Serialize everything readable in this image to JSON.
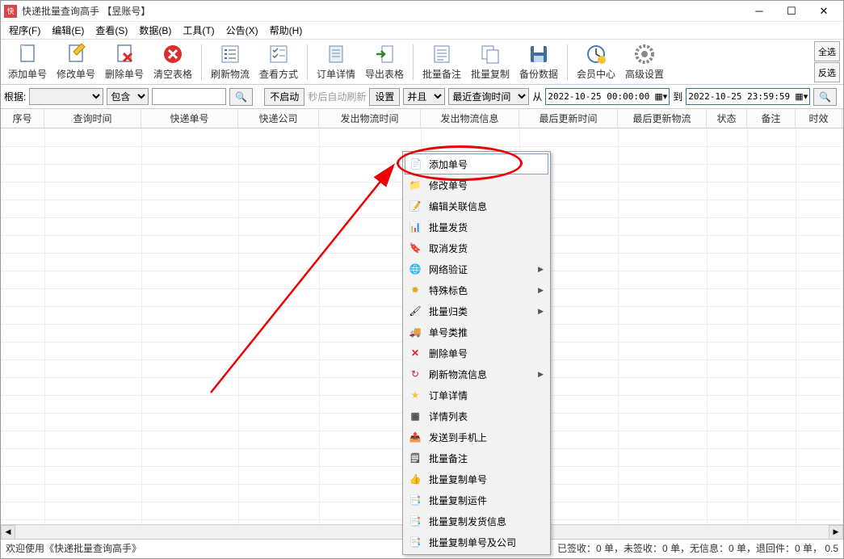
{
  "window": {
    "title": "快递批量查询高手  【昱账号】"
  },
  "menu": {
    "program": "程序(F)",
    "edit": "编辑(E)",
    "view": "查看(S)",
    "data": "数据(B)",
    "tool": "工具(T)",
    "notice": "公告(X)",
    "help": "帮助(H)"
  },
  "toolbar": {
    "add": "添加单号",
    "modify": "修改单号",
    "delete": "删除单号",
    "clear": "清空表格",
    "refresh": "刷新物流",
    "viewmode": "查看方式",
    "detail": "订单详情",
    "export": "导出表格",
    "remark": "批量备注",
    "copy": "批量复制",
    "backup": "备份数据",
    "member": "会员中心",
    "advanced": "高级设置",
    "selectall": "全选",
    "invert": "反选"
  },
  "filter": {
    "root_label": "根据:",
    "contain": "包含",
    "nostart": "不启动",
    "auto_hint": "秒后自动刷新",
    "setting": "设置",
    "and": "并且",
    "lastquery": "最近查询时间",
    "from": "从",
    "to": "到",
    "date_from": "2022-10-25 00:00:00",
    "date_to": "2022-10-25 23:59:59"
  },
  "cols": {
    "c0": "序号",
    "c1": "查询时间",
    "c2": "快递单号",
    "c3": "快递公司",
    "c4": "发出物流时间",
    "c5": "发出物流信息",
    "c6": "最后更新时间",
    "c7": "最后更新物流",
    "c8": "状态",
    "c9": "备注",
    "c10": "时效"
  },
  "ctx": {
    "i0": "添加单号",
    "i1": "修改单号",
    "i2": "编辑关联信息",
    "i3": "批量发货",
    "i4": "取消发货",
    "i5": "网络验证",
    "i6": "特殊标色",
    "i7": "批量归类",
    "i8": "单号类推",
    "i9": "删除单号",
    "i10": "刷新物流信息",
    "i11": "订单详情",
    "i12": "详情列表",
    "i13": "发送到手机上",
    "i14": "批量备注",
    "i15": "批量复制单号",
    "i16": "批量复制运件",
    "i17": "批量复制发货信息",
    "i18": "批量复制单号及公司"
  },
  "status": {
    "welcome": "欢迎使用《快递批量查询高手》",
    "right": "共：0 单，已签收：0 单，未签收：0 单，无信息：0 单，退回件：0 单，  0.5"
  }
}
